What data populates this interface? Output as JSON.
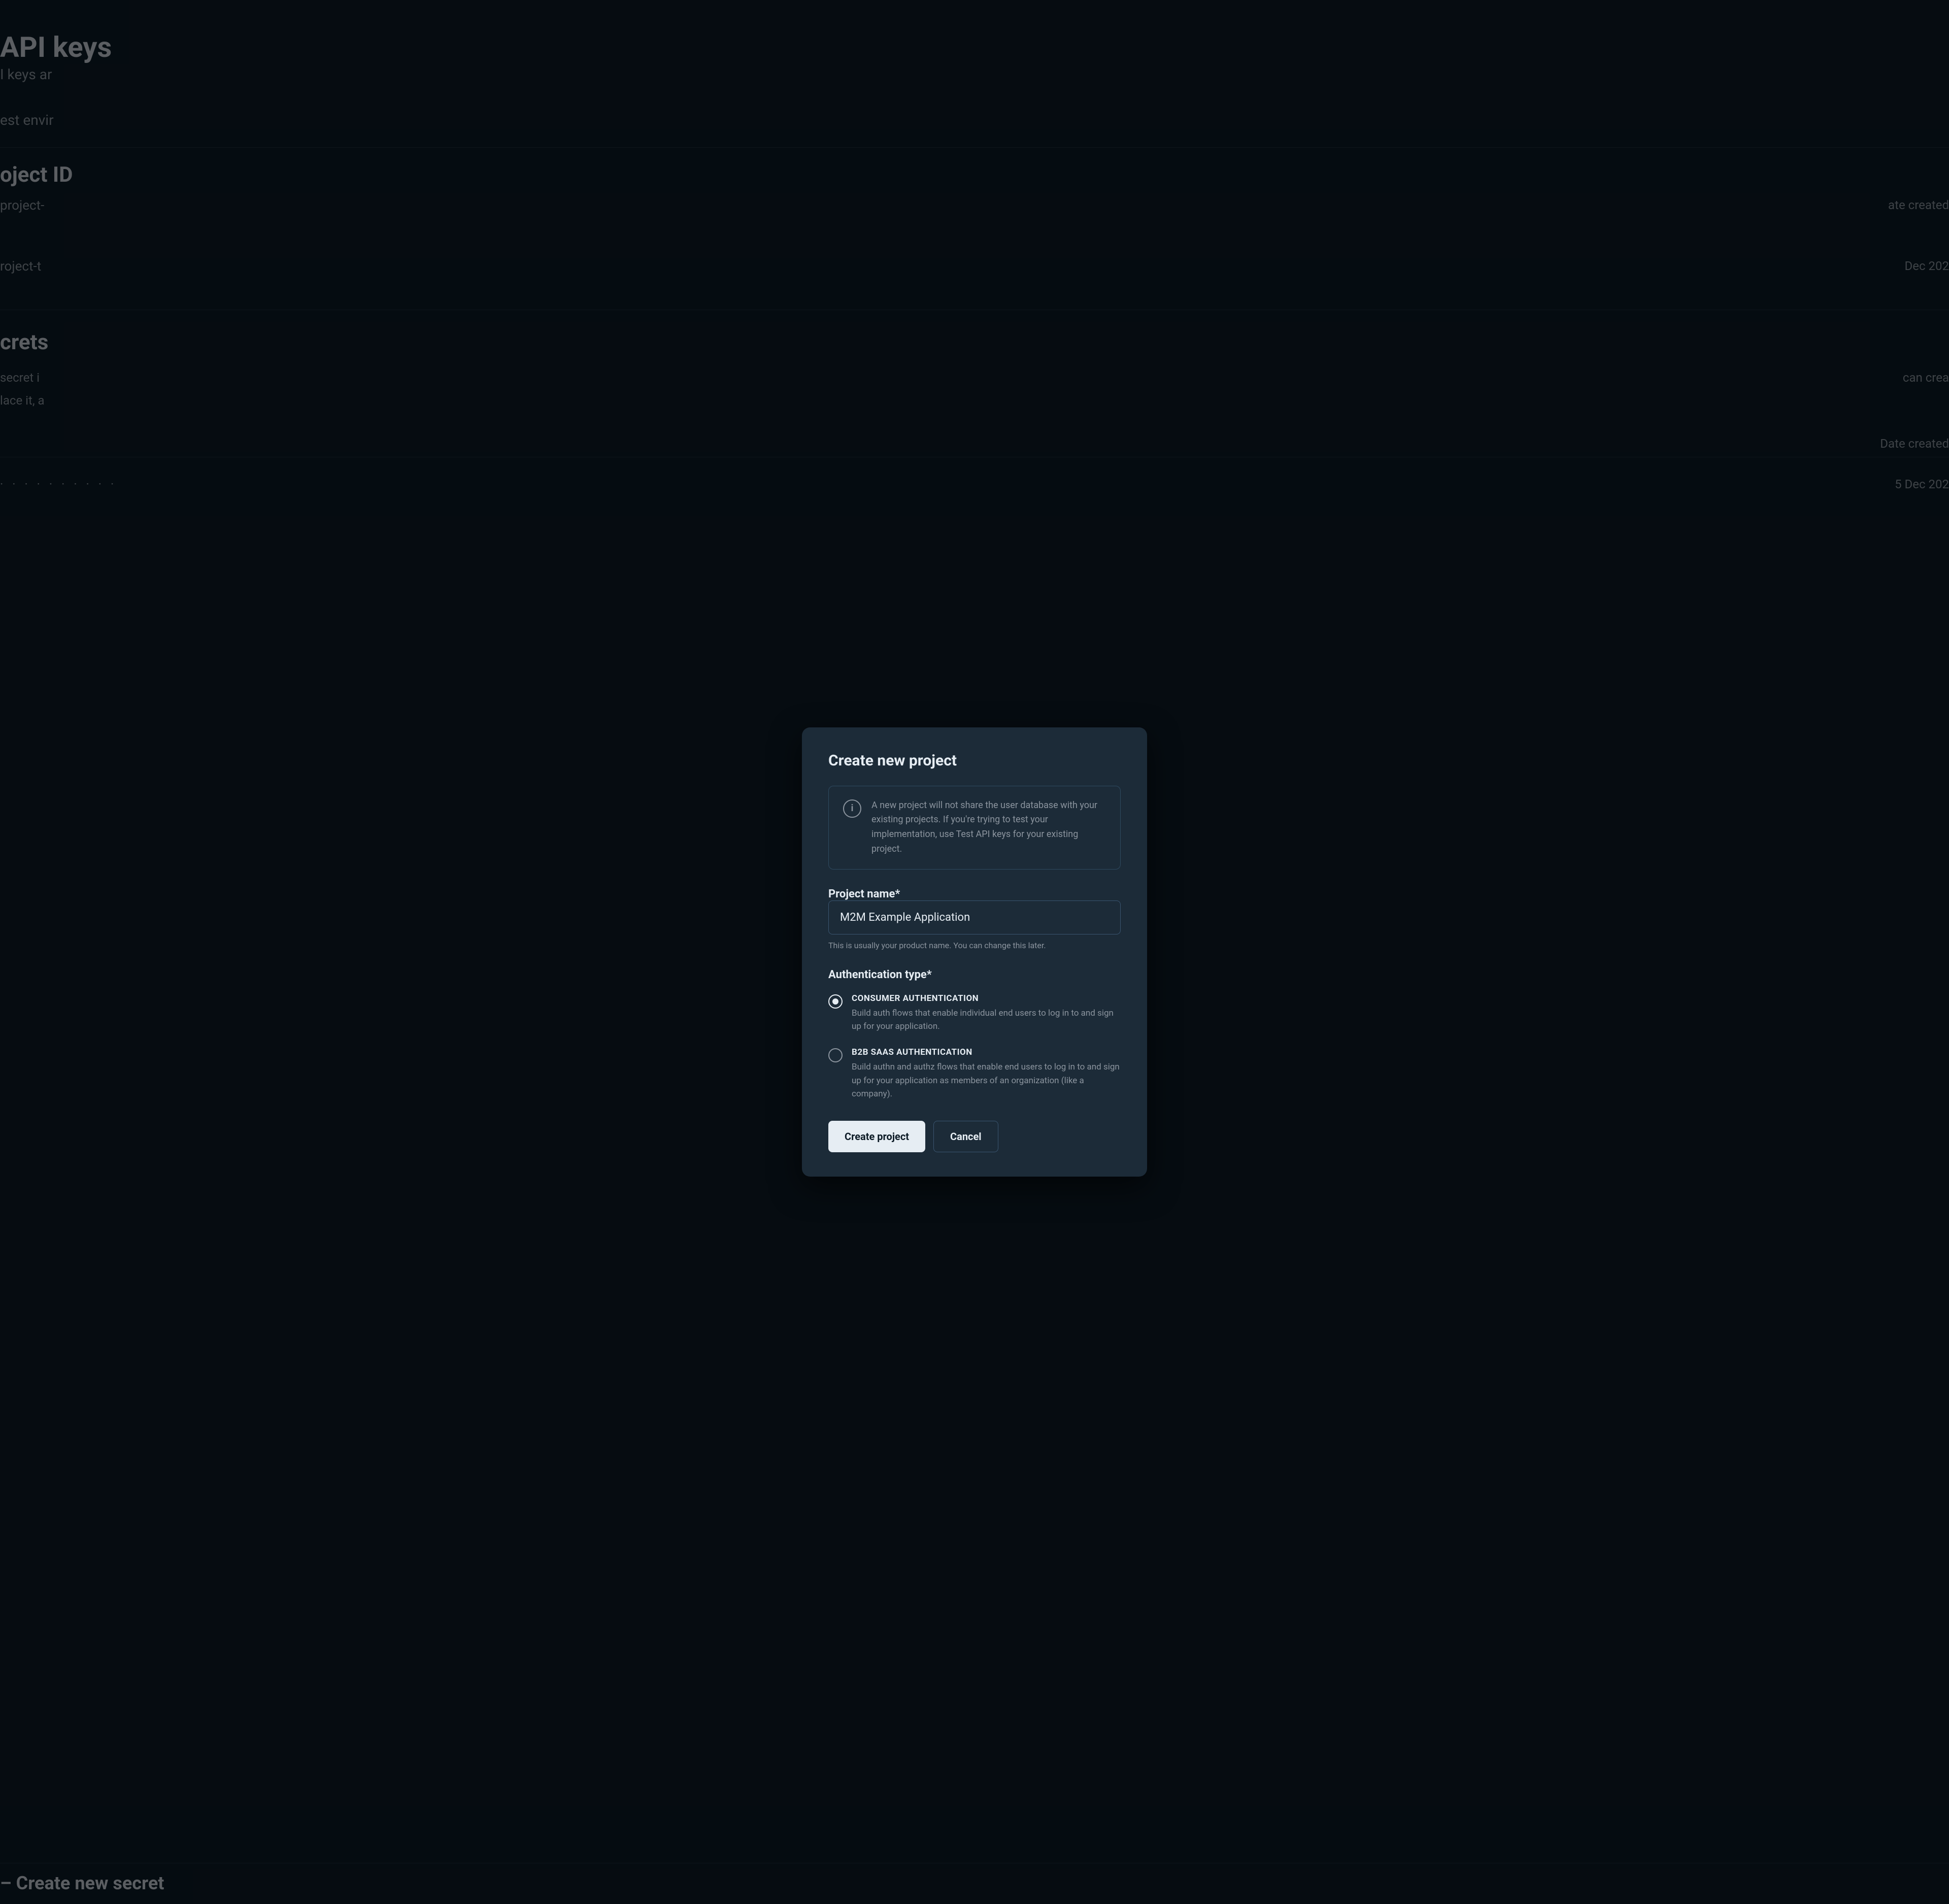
{
  "backdrop": {
    "api_keys_title": "API keys",
    "api_keys_sub": "I keys ar",
    "test_env": "est envir",
    "project_id_label": "oject ID",
    "project_val": "project-",
    "date_created_right": "ate created",
    "project_val2": "roject-t",
    "dec2": "Dec 202",
    "secrets_label": "crets",
    "secret_text": "secret i",
    "can_create": "can crea",
    "replace_text": "lace it, a",
    "date_bottom_right": "Date created",
    "dots": "· · · · · · · · · ·",
    "dec_bottom": "5 Dec 202",
    "create_new_secret": "– Create new secret"
  },
  "modal": {
    "title": "Create new project",
    "info_box": {
      "text": "A new project will not share the user database with your existing projects. If you're trying to test your implementation, use Test API keys for your existing project."
    },
    "project_name": {
      "label": "Project name*",
      "value": "M2M Example Application",
      "hint": "This is usually your product name. You can change this later."
    },
    "auth_type": {
      "label": "Authentication type*",
      "options": [
        {
          "id": "consumer",
          "title": "CONSUMER AUTHENTICATION",
          "description": "Build auth flows that enable individual end users to log in to and sign up for your application.",
          "selected": true
        },
        {
          "id": "b2b",
          "title": "B2B SAAS AUTHENTICATION",
          "description": "Build authn and authz flows that enable end users to log in to and sign up for your application as members of an organization (like a company).",
          "selected": false
        }
      ]
    },
    "buttons": {
      "create_label": "Create project",
      "cancel_label": "Cancel"
    }
  }
}
